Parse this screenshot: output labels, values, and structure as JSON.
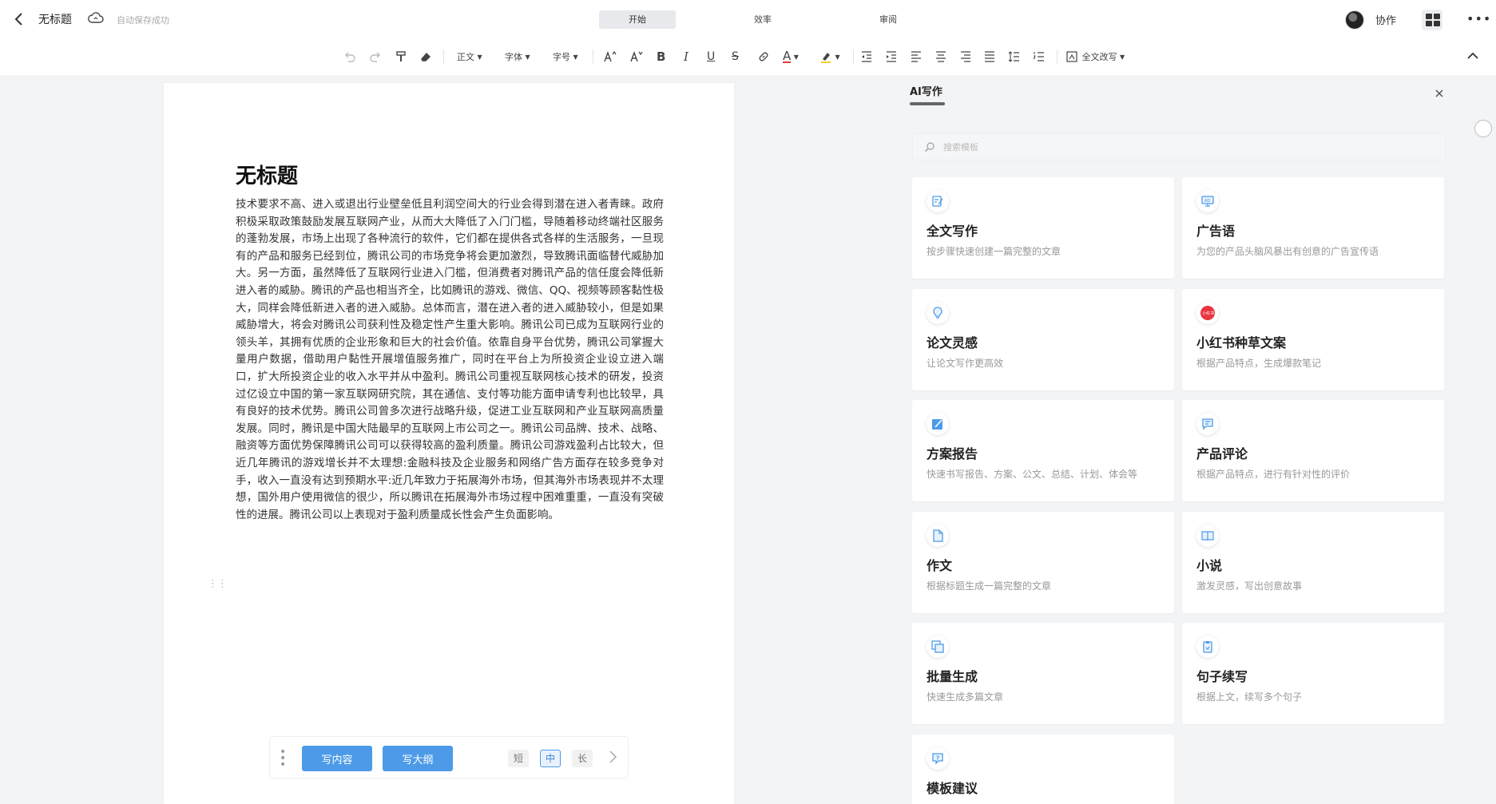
{
  "header": {
    "doc_title": "无标题",
    "save_status": "自动保存成功",
    "tabs": [
      {
        "label": "开始",
        "active": true
      },
      {
        "label": "效率",
        "active": false
      },
      {
        "label": "审阅",
        "active": false
      }
    ],
    "collab_label": "协作"
  },
  "toolbar": {
    "style_select": "正文",
    "font_select": "字体",
    "size_select": "字号",
    "rewrite_label": "全文改写"
  },
  "document": {
    "title": "无标题",
    "body": "技术要求不高、进入或退出行业壁垒低且利润空间大的行业会得到潜在进入者青睐。政府积极采取政策鼓励发展互联网产业，从而大大降低了入门门槛，导随着移动终端社区服务的蓬勃发展，市场上出现了各种流行的软件，它们都在提供各式各样的生活服务，一旦现有的产品和服务已经到位，腾讯公司的市场竞争将会更加激烈，导致腾讯面临替代威胁加大。另一方面，虽然降低了互联网行业进入门槛，但消费者对腾讯产品的信任度会降低新进入者的威胁。腾讯的产品也相当齐全，比如腾讯的游戏、微信、QQ、视频等顾客黏性极大，同样会降低新进入者的进入威胁。总体而言，潜在进入者的进入威胁较小，但是如果威胁增大，将会对腾讯公司获利性及稳定性产生重大影响。腾讯公司已成为互联网行业的领头羊，其拥有优质的企业形象和巨大的社会价值。依靠自身平台优势，腾讯公司掌握大量用户数据，借助用户黏性开展增值服务推广，同时在平台上为所投资企业设立进入端口，扩大所投资企业的收入水平并从中盈利。腾讯公司重视互联网核心技术的研发，投资过亿设立中国的第一家互联网研究院，其在通信、支付等功能方面申请专利也比较早，具有良好的技术优势。腾讯公司曾多次进行战略升级，促进工业互联网和产业互联网高质量发展。同时，腾讯是中国大陆最早的互联网上市公司之一。腾讯公司品牌、技术、战略、融资等方面优势保障腾讯公司可以获得较高的盈利质量。腾讯公司游戏盈利占比较大，但近几年腾讯的游戏增长并不太理想:金融科技及企业服务和网络广告方面存在较多竞争对手，收入一直没有达到预期水平:近几年致力于拓展海外市场，但其海外市场表现并不太理想，国外用户使用微信的很少，所以腾讯在拓展海外市场过程中困难重重，一直没有突破性的进展。腾讯公司以上表现对于盈利质量成长性会产生负面影响。"
  },
  "ai_bar": {
    "write_content_label": "写内容",
    "write_outline_label": "写大纲",
    "length_options": [
      "短",
      "中",
      "长"
    ],
    "selected_length": "中"
  },
  "ai_panel": {
    "title": "AI写作",
    "search_placeholder": "搜索模板",
    "accent_color": "#4d9be8",
    "cards": [
      {
        "title": "全文写作",
        "desc": "按步骤快速创建一篇完整的文章",
        "icon": "edit-doc-icon"
      },
      {
        "title": "广告语",
        "desc": "为您的产品头脑风暴出有创意的广告宣传语",
        "icon": "ad-icon"
      },
      {
        "title": "论文灵感",
        "desc": "让论文写作更高效",
        "icon": "lightbulb-icon"
      },
      {
        "title": "小红书种草文案",
        "desc": "根据产品特点，生成爆款笔记",
        "icon": "xiaohongshu-icon"
      },
      {
        "title": "方案报告",
        "desc": "快速书写报告、方案、公文、总结、计划、体会等",
        "icon": "report-icon"
      },
      {
        "title": "产品评论",
        "desc": "根据产品特点，进行有针对性的评价",
        "icon": "comment-icon"
      },
      {
        "title": "作文",
        "desc": "根据标题生成一篇完整的文章",
        "icon": "file-icon"
      },
      {
        "title": "小说",
        "desc": "激发灵感，写出创意故事",
        "icon": "book-icon"
      },
      {
        "title": "批量生成",
        "desc": "快速生成多篇文章",
        "icon": "copy-icon"
      },
      {
        "title": "句子续写",
        "desc": "根据上文，续写多个句子",
        "icon": "clipboard-icon"
      },
      {
        "title": "模板建议",
        "desc": "",
        "icon": "question-icon"
      }
    ]
  }
}
